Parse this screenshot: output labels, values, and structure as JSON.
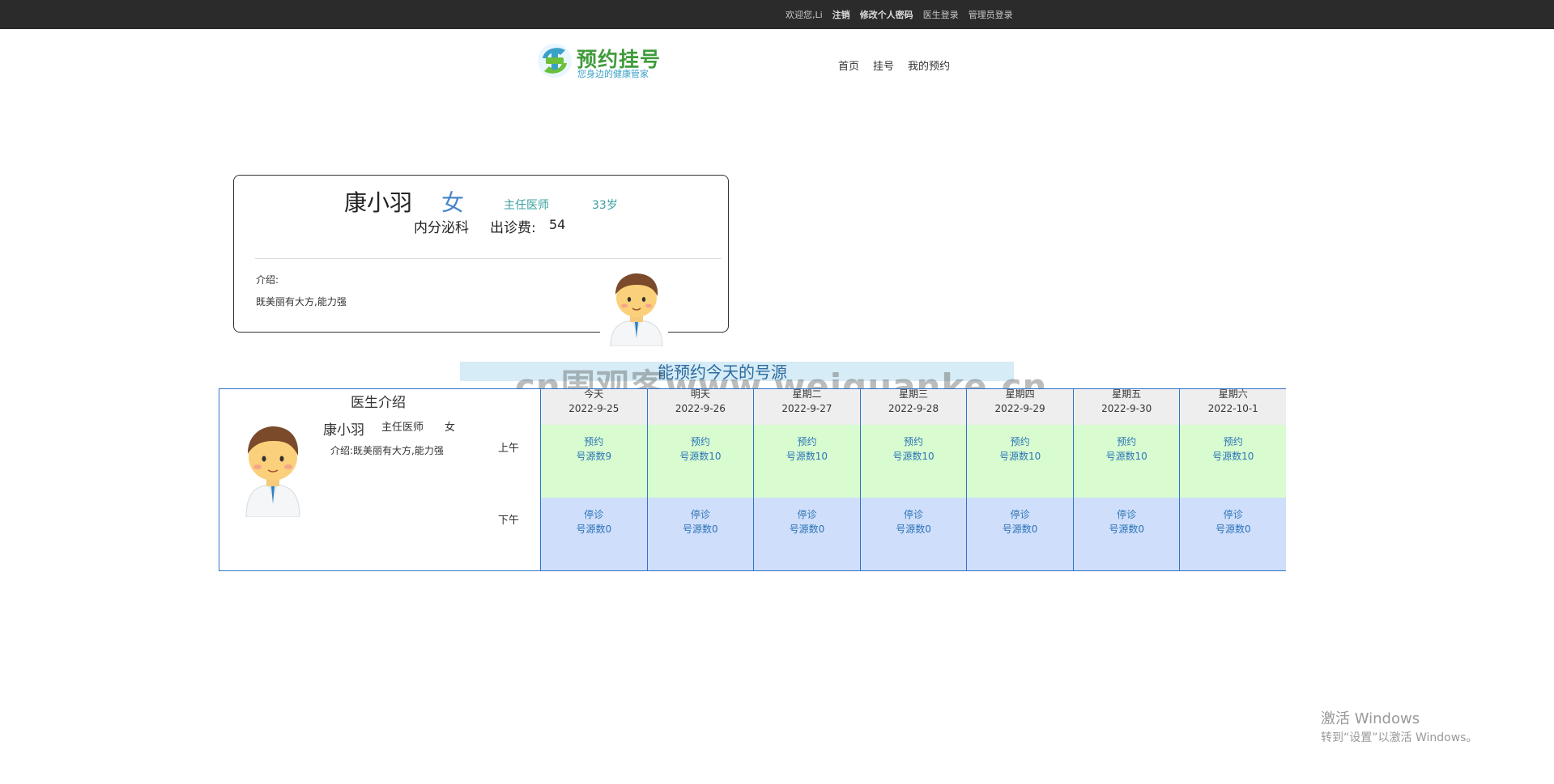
{
  "topbar": {
    "welcome": "欢迎您,Li",
    "logout": "注销",
    "change_password": "修改个人密码",
    "doctor_login": "医生登录",
    "admin_login": "管理员登录"
  },
  "header": {
    "logo_title": "预约挂号",
    "logo_sub": "您身边的健康管家",
    "nav": [
      "首页",
      "挂号",
      "我的预约"
    ]
  },
  "doctor_card": {
    "name": "康小羽",
    "gender": "女",
    "title": "主任医师",
    "age": "33岁",
    "department": "内分泌科",
    "fee_label": "出诊费:",
    "fee_value": "54",
    "intro_label": "介绍:",
    "intro_text": "既美丽有大方,能力强"
  },
  "notice": {
    "text": "能预约今天的号源",
    "watermark": "cn围观客www.weiguanke.cn"
  },
  "schedule": {
    "doctor_header": "医生介绍",
    "doctor_name": "康小羽",
    "doctor_title": "主任医师",
    "doctor_gender": "女",
    "doctor_intro": "介绍:既美丽有大方,能力强",
    "am_label": "上午",
    "pm_label": "下午",
    "days": [
      {
        "weekday": "今天",
        "date": "2022-9-25",
        "am_status": "预约",
        "am_count": "号源数9",
        "pm_status": "停诊",
        "pm_count": "号源数0"
      },
      {
        "weekday": "明天",
        "date": "2022-9-26",
        "am_status": "预约",
        "am_count": "号源数10",
        "pm_status": "停诊",
        "pm_count": "号源数0"
      },
      {
        "weekday": "星期二",
        "date": "2022-9-27",
        "am_status": "预约",
        "am_count": "号源数10",
        "pm_status": "停诊",
        "pm_count": "号源数0"
      },
      {
        "weekday": "星期三",
        "date": "2022-9-28",
        "am_status": "预约",
        "am_count": "号源数10",
        "pm_status": "停诊",
        "pm_count": "号源数0"
      },
      {
        "weekday": "星期四",
        "date": "2022-9-29",
        "am_status": "预约",
        "am_count": "号源数10",
        "pm_status": "停诊",
        "pm_count": "号源数0"
      },
      {
        "weekday": "星期五",
        "date": "2022-9-30",
        "am_status": "预约",
        "am_count": "号源数10",
        "pm_status": "停诊",
        "pm_count": "号源数0"
      },
      {
        "weekday": "星期六",
        "date": "2022-10-1",
        "am_status": "预约",
        "am_count": "号源数10",
        "pm_status": "停诊",
        "pm_count": "号源数0"
      }
    ]
  },
  "windows_activation": {
    "line1": "激活 Windows",
    "line2": "转到“设置”以激活 Windows。"
  },
  "colors": {
    "topbar_bg": "#2b2b2b",
    "table_border": "#2f74c8",
    "am_bg": "#d8fcd0",
    "pm_bg": "#cfdefa",
    "logo_green": "#3f9c3a"
  }
}
